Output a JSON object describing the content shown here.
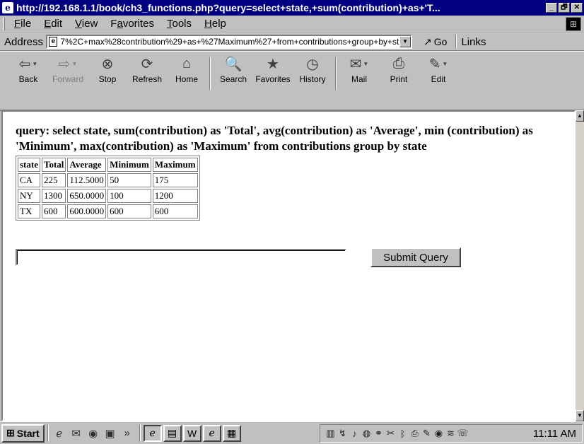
{
  "window": {
    "title": "http://192.168.1.1/book/ch3_functions.php?query=select+state,+sum(contribution)+as+'T...",
    "controls": [
      "_",
      "🗗",
      "✕"
    ]
  },
  "menu": [
    {
      "label": "File",
      "key": "F",
      "rest": "ile"
    },
    {
      "label": "Edit",
      "key": "E",
      "rest": "dit"
    },
    {
      "label": "View",
      "key": "V",
      "rest": "iew"
    },
    {
      "label": "Favorites",
      "pre": "F",
      "key": "a",
      "rest": "vorites"
    },
    {
      "label": "Tools",
      "key": "T",
      "rest": "ools"
    },
    {
      "label": "Help",
      "key": "H",
      "rest": "elp"
    }
  ],
  "address": {
    "label": "Address",
    "value": "7%2C+max%28contribution%29+as+%27Maximum%27+from+contributions+group+by+state",
    "go": "Go",
    "links": "Links"
  },
  "toolbar": [
    {
      "label": "Back",
      "icon": "⇦",
      "name": "back",
      "dropdown": true,
      "disabled": false
    },
    {
      "label": "Forward",
      "icon": "⇨",
      "name": "forward",
      "dropdown": true,
      "disabled": true
    },
    {
      "label": "Stop",
      "icon": "⊗",
      "name": "stop",
      "dropdown": false,
      "disabled": false
    },
    {
      "label": "Refresh",
      "icon": "⟳",
      "name": "refresh",
      "dropdown": false,
      "disabled": false
    },
    {
      "label": "Home",
      "icon": "⌂",
      "name": "home",
      "dropdown": false,
      "disabled": false
    },
    {
      "label": "Search",
      "icon": "🔍",
      "name": "search",
      "dropdown": false,
      "disabled": false
    },
    {
      "label": "Favorites",
      "icon": "★",
      "name": "favorites",
      "dropdown": false,
      "disabled": false
    },
    {
      "label": "History",
      "icon": "◷",
      "name": "history",
      "dropdown": false,
      "disabled": false
    },
    {
      "label": "Mail",
      "icon": "✉",
      "name": "mail",
      "dropdown": true,
      "disabled": false
    },
    {
      "label": "Print",
      "icon": "⎙",
      "name": "print",
      "dropdown": false,
      "disabled": false
    },
    {
      "label": "Edit",
      "icon": "✎",
      "name": "edit",
      "dropdown": true,
      "disabled": false
    }
  ],
  "content": {
    "query_text": "query: select state, sum(contribution) as 'Total', avg(contribution) as 'Average', min (contribution) as 'Minimum', max(contribution) as 'Maximum' from contributions group by state",
    "table": {
      "headers": [
        "state",
        "Total",
        "Average",
        "Minimum",
        "Maximum"
      ],
      "rows": [
        [
          "CA",
          "225",
          "112.5000",
          "50",
          "175"
        ],
        [
          "NY",
          "1300",
          "650.0000",
          "100",
          "1200"
        ],
        [
          "TX",
          "600",
          "600.0000",
          "600",
          "600"
        ]
      ]
    },
    "input_value": "",
    "submit_label": "Submit Query"
  },
  "taskbar": {
    "start_label": "Start",
    "quicklaunch": [
      "ie-icon",
      "outlook-icon",
      "realplayer-icon",
      "desktop-icon"
    ],
    "chevron": "»",
    "tasks": [
      "ie-window-icon",
      "explorer-window-icon",
      "word-window-icon",
      "ie-window-icon-2",
      "notepad-window-icon"
    ],
    "tray_icons": [
      "network-icon",
      "connection-icon",
      "speaker-icon",
      "antivirus-icon",
      "link-icon",
      "tool-icon",
      "bluetooth-icon",
      "printer-icon",
      "pen-icon",
      "realplayer-tray-icon",
      "mixer-icon",
      "chat-icon"
    ],
    "clock": "11:11 AM"
  }
}
